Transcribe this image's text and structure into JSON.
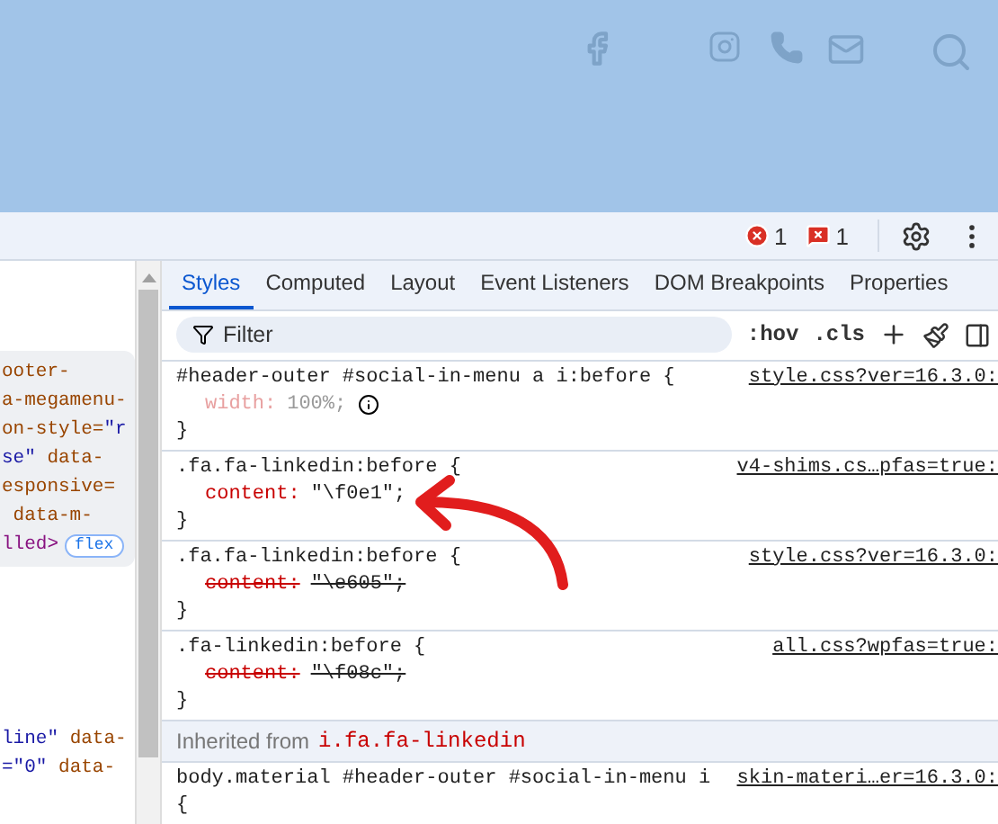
{
  "toolbar": {
    "errors": "1",
    "issues": "1"
  },
  "elements_panel": {
    "lines": [
      {
        "segments": [
          {
            "text": "ooter-",
            "kind": "attr"
          }
        ]
      },
      {
        "segments": [
          {
            "text": "a-megamenu-",
            "kind": "attr"
          }
        ]
      },
      {
        "segments": [
          {
            "text": "on-style=",
            "kind": "attr"
          },
          {
            "text": "\"r",
            "kind": "value"
          }
        ]
      },
      {
        "segments": [
          {
            "text": "se\"",
            "kind": "value"
          },
          {
            "text": " data-",
            "kind": "attr"
          }
        ]
      },
      {
        "segments": [
          {
            "text": "esponsive=",
            "kind": "attr"
          }
        ]
      },
      {
        "segments": [
          {
            "text": " data-m-",
            "kind": "attr"
          }
        ]
      },
      {
        "segments": [
          {
            "text": "lled>",
            "kind": "tag"
          }
        ],
        "badge": "flex"
      }
    ],
    "lower_lines": [
      {
        "segments": [
          {
            "text": "line\"",
            "kind": "value"
          },
          {
            "text": " data-",
            "kind": "attr"
          }
        ]
      },
      {
        "segments": [
          {
            "text": "=\"0\"",
            "kind": "value"
          },
          {
            "text": " data-",
            "kind": "attr"
          }
        ]
      }
    ]
  },
  "tabs": [
    {
      "label": "Styles",
      "selected": true
    },
    {
      "label": "Computed",
      "selected": false
    },
    {
      "label": "Layout",
      "selected": false
    },
    {
      "label": "Event Listeners",
      "selected": false
    },
    {
      "label": "DOM Breakpoints",
      "selected": false
    },
    {
      "label": "Properties",
      "selected": false
    }
  ],
  "filter": {
    "placeholder": "Filter",
    "hov": ":hov",
    "cls": ".cls"
  },
  "rules": [
    {
      "selector": "#header-outer #social-in-menu a i:before {",
      "source": "style.css?ver=16.3.0:",
      "declarations": [
        {
          "property": "width:",
          "value": "100%;",
          "inactive": true,
          "overridden": false
        }
      ],
      "close": "}"
    },
    {
      "selector": ".fa.fa-linkedin:before {",
      "source": "v4-shims.cs…pfas=true:",
      "declarations": [
        {
          "property": "content:",
          "value": "\"\\f0e1\";",
          "inactive": false,
          "overridden": false
        }
      ],
      "close": "}"
    },
    {
      "selector": ".fa.fa-linkedin:before {",
      "source": "style.css?ver=16.3.0:",
      "declarations": [
        {
          "property": "content:",
          "value": "\"\\e605\";",
          "inactive": false,
          "overridden": true
        }
      ],
      "close": "}"
    },
    {
      "selector": ".fa-linkedin:before {",
      "source": "all.css?wpfas=true:",
      "declarations": [
        {
          "property": "content:",
          "value": "\"\\f08c\";",
          "inactive": false,
          "overridden": true
        }
      ],
      "close": "}"
    }
  ],
  "inherited": {
    "label": "Inherited from",
    "element": "i.fa.fa-linkedin"
  },
  "last_rule": {
    "selector": "body.material #header-outer #social-in-menu i",
    "source": "skin-materi…er=16.3.0:",
    "open": "{"
  }
}
